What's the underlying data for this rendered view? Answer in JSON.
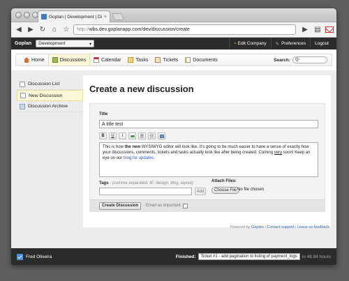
{
  "browser": {
    "tab_title": "Goplan | Development | Disc",
    "tab_close": "×",
    "url_scheme": "http://",
    "url_rest": "wbs.dev.goplanapp.com/dev/discussion/create"
  },
  "app_bar": {
    "brand": "Goplan",
    "project": "Development",
    "links": [
      "Edit Company",
      "Preferences",
      "Logout"
    ]
  },
  "nav": {
    "items": [
      {
        "label": "Home",
        "icon": "home-icon",
        "color": "#d26a2a"
      },
      {
        "label": "Discussions",
        "icon": "discussions-icon",
        "color": "#7a9b3a"
      },
      {
        "label": "Calendar",
        "icon": "calendar-icon",
        "color": "#c23b3b"
      },
      {
        "label": "Tasks",
        "icon": "tasks-icon",
        "color": "#d08b2a"
      },
      {
        "label": "Tickets",
        "icon": "tickets-icon",
        "color": "#c9a04a"
      },
      {
        "label": "Documents",
        "icon": "documents-icon",
        "color": "#e0a63a"
      }
    ],
    "search_label": "Search:",
    "search_placeholder": "Q-"
  },
  "sidebar": {
    "items": [
      {
        "label": "Discussion List"
      },
      {
        "label": "New Discussion"
      },
      {
        "label": "Discussion Archive"
      }
    ]
  },
  "form": {
    "heading": "Create a new discussion",
    "title_label": "Title",
    "title_value": "A title test",
    "editor_buttons": [
      "B",
      "U",
      "I",
      "link",
      "ol",
      "ul",
      "img"
    ],
    "body_part1": "This is how ",
    "body_bold": "the new",
    "body_part2": " WYSIWYG editor will look like. It's going to be much easier to have a sense of exactly how your discussions, comments, tickets and tasks actually look like after being created. Coming ",
    "body_underline": "very",
    "body_part3": " soon! Keep an eye on our ",
    "body_link": "blog for updates.",
    "tags_label": "Tags",
    "tags_hint": " - (comma separated. IE: design, blog, layout)",
    "add_button": "Add",
    "attach_label": "Attach Files:",
    "file_button": "Choose File",
    "file_status": "No file chosen",
    "submit_button": "Create Discussion",
    "important_label": "- Email as important"
  },
  "footer": {
    "powered_prefix": "Powered by ",
    "powered_link": "Goplan",
    "separator": " / ",
    "contact_link": "Contact support",
    "feedback_link": "Leave us feedback"
  },
  "status_bar": {
    "user": "Fred Oliveira",
    "finished_label": "Finished:",
    "ticket": "Ticket #1 - add pagination to listing of payment_logs",
    "time": "in 48.84 hours"
  }
}
